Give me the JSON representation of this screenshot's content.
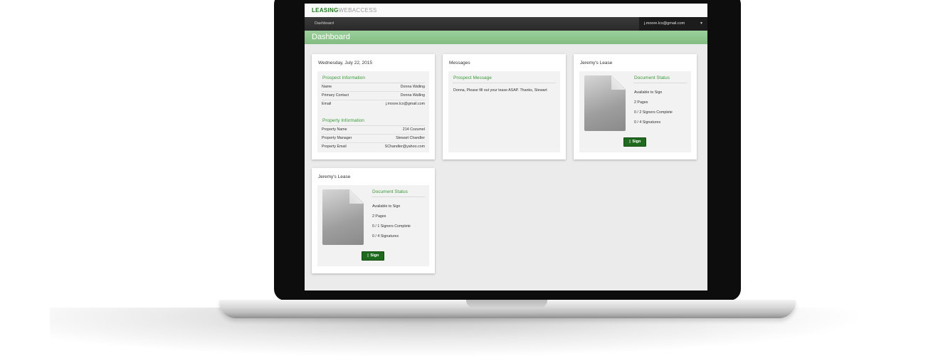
{
  "brand": {
    "strong": "LEASING",
    "light": "WEBACCESS"
  },
  "nav": {
    "dashboard": "Dashboard",
    "user_email": "j.moore.lcs@gmail.com",
    "caret": "▼"
  },
  "page_title": "Dashboard",
  "date_card": {
    "title": "Wednesday, July 22, 2015",
    "prospect": {
      "heading": "Prospect Information",
      "rows": [
        {
          "label": "Name",
          "value": "Donna Walling"
        },
        {
          "label": "Primary Contact",
          "value": "Donna Walling"
        },
        {
          "label": "Email",
          "value": "j.moore.lcs@gmail.com"
        }
      ]
    },
    "property": {
      "heading": "Property Information",
      "rows": [
        {
          "label": "Property Name",
          "value": "214 Cozumel"
        },
        {
          "label": "Property Manager",
          "value": "Stewart Chandler"
        },
        {
          "label": "Property Email",
          "value": "SChandler@yahoo.com"
        }
      ]
    }
  },
  "messages_card": {
    "title": "Messages",
    "heading": "Prospect Message",
    "body": "Donna, Please fill out your lease ASAP. Thanks, Stewart"
  },
  "lease_cards": [
    {
      "title": "Jeremy's Lease",
      "heading": "Document Status",
      "lines": [
        "Available to Sign",
        "2 Pages",
        "0 / 2 Signers Complete",
        "0 / 4 Signatures"
      ],
      "button": "Sign",
      "button_icon": "document-icon"
    },
    {
      "title": "Jeremy's Lease",
      "heading": "Document Status",
      "lines": [
        "Available to Sign",
        "2 Pages",
        "0 / 1 Signers Complete",
        "0 / 4 Signatures"
      ],
      "button": "Sign",
      "button_icon": "document-icon"
    }
  ],
  "colors": {
    "accent": "#3c9a3c",
    "title_bar": "#8cc58c",
    "nav_bar": "#333333",
    "button": "#1f6a1f"
  }
}
